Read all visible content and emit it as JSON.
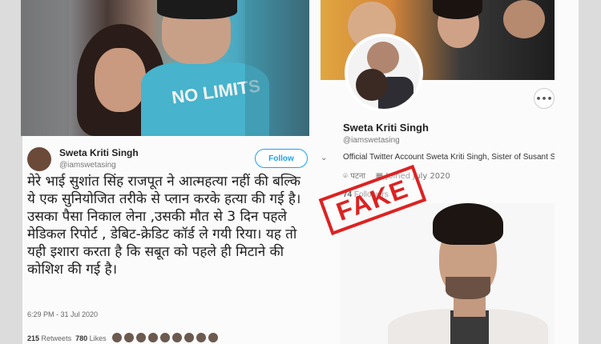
{
  "tweet": {
    "name": "Sweta Kriti Singh",
    "handle": "@iamswetasing",
    "follow_label": "Follow",
    "chevron": "⌄",
    "shirt_text": "NO LIMITS",
    "body": [
      "मेरे भाई सुशांत सिंह राजपूत ने आत्महत्या नहीं की बल्कि ये एक सुनियोजित तरीके से प्लान करके हत्या की गई है।",
      "उसका पैसा निकाल लेना ,उसकी मौत से 3 दिन पहले मेडिकल रिपोर्ट , डेबिट-क्रेडिट कॉर्ड ले गयी रिया। यह तो यही इशारा करता है कि सबूत को पहले ही मिटाने की कोशिश की गई है।"
    ],
    "time": "6:29 PM - 31 Jul 2020",
    "retweets_count": "215",
    "retweets_label": "Retweets",
    "likes_count": "780",
    "likes_label": "Likes"
  },
  "profile": {
    "name": "Sweta Kriti Singh",
    "handle": "@iamswetasing",
    "bio": "Official Twitter Account Sweta Kriti Singh,  Sister of Susant S",
    "location": "पटना",
    "joined": "Joined July 2020",
    "followers_count": "74",
    "followers_label": "Followers",
    "more_label": "•••"
  },
  "stamp": {
    "text": "FAKE",
    "color": "#dd2222"
  },
  "icons": [
    "location-icon",
    "calendar-icon",
    "chevron-down-icon"
  ]
}
